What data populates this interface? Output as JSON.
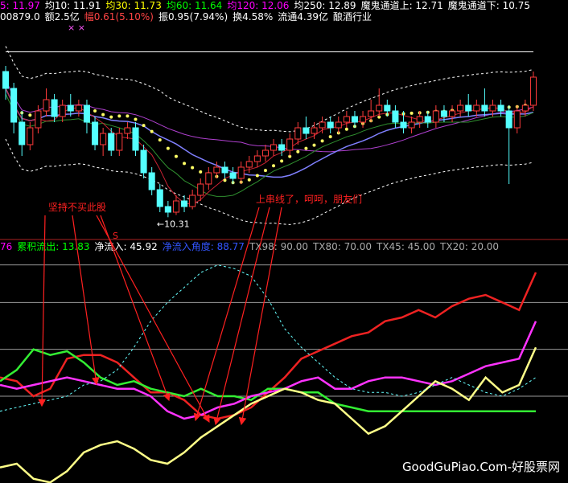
{
  "header": {
    "ma_items": [
      {
        "text": "5: 11.97",
        "color": "#ff00ff"
      },
      {
        "text": "均10: 11.91",
        "color": "#ffffff"
      },
      {
        "text": "均30: 11.73",
        "color": "#ffff00"
      },
      {
        "text": "均60: 11.64",
        "color": "#00ff00"
      },
      {
        "text": "均120: 12.06",
        "color": "#ff00ff"
      },
      {
        "text": "均250: 12.89",
        "color": "#ffffff"
      },
      {
        "text": "魔鬼通道上: 12.71",
        "color": "#ffffff"
      },
      {
        "text": "魔鬼通道下: 10.75",
        "color": "#ffffff"
      }
    ],
    "info_items": [
      {
        "text": "00879.0",
        "color": "#ffffff"
      },
      {
        "text": "额2.5亿",
        "color": "#ffffff"
      },
      {
        "text": "幅0.61(5.10%)",
        "color": "#ff4444"
      },
      {
        "text": "振0.95(7.94%)",
        "color": "#ffffff"
      },
      {
        "text": "换4.58%",
        "color": "#ffffff"
      },
      {
        "text": "流通4.39亿",
        "color": "#ffffff"
      },
      {
        "text": "酿酒行业",
        "color": "#ffffff"
      }
    ],
    "marks": "× ×"
  },
  "indicator_header": [
    {
      "text": "76",
      "color": "#ff00ff"
    },
    {
      "text": "累积流出: 13.83",
      "color": "#00ff00"
    },
    {
      "text": "净流入: 45.92",
      "color": "#ffffff"
    },
    {
      "text": "净流入角度: 88.77",
      "color": "#3355ff"
    },
    {
      "text": "TX98: 90.00",
      "color": "#aaaaaa"
    },
    {
      "text": "TX80: 70.00",
      "color": "#aaaaaa"
    },
    {
      "text": "TX45: 45.00",
      "color": "#aaaaaa"
    },
    {
      "text": "TX20: 20.00",
      "color": "#aaaaaa"
    }
  ],
  "annotations": {
    "left": "坚持不买此股",
    "right": "上串线了，呵呵，朋友们",
    "low_price": "10.31",
    "marker": "S"
  },
  "watermark": "GoodGuPiao.Com-好股票网",
  "colors": {
    "up": "#ff3b3b",
    "down": "#54ffff",
    "annotation": "#ff2020",
    "ma_white": "#ffffff",
    "ma_green": "#2f8f2f",
    "ma_purple": "#b040d0",
    "ma_blue": "#8080ff",
    "ma_yellow_dots": "#ffff66",
    "line_red": "#ee2222",
    "line_magenta": "#ff33ff",
    "line_green": "#33ee33",
    "line_yellow": "#ffff88",
    "line_cyan_dash": "#66ffff"
  },
  "chart_data": [
    {
      "type": "line",
      "name": "price-panel",
      "x": [
        1,
        2,
        3,
        4,
        5,
        6,
        7,
        8,
        9,
        10,
        11,
        12,
        13,
        14,
        15,
        16,
        17,
        18,
        19,
        20,
        21,
        22,
        23,
        24,
        25,
        26,
        27,
        28,
        29,
        30,
        31,
        32,
        33,
        34,
        35,
        36,
        37,
        38,
        39,
        40,
        41,
        42,
        43,
        44,
        45,
        46,
        47,
        48,
        49,
        50,
        51,
        52,
        53,
        54,
        55,
        56,
        57,
        58,
        59,
        60,
        61,
        62,
        63,
        64,
        65,
        66
      ],
      "candles": [
        {
          "o": 12.9,
          "c": 12.6,
          "h": 13.0,
          "l": 12.4
        },
        {
          "o": 12.6,
          "c": 12.0,
          "h": 12.7,
          "l": 11.8
        },
        {
          "o": 12.0,
          "c": 11.6,
          "h": 12.2,
          "l": 11.4
        },
        {
          "o": 11.6,
          "c": 11.9,
          "h": 12.0,
          "l": 11.5
        },
        {
          "o": 11.9,
          "c": 12.2,
          "h": 12.3,
          "l": 11.8
        },
        {
          "o": 12.2,
          "c": 12.4,
          "h": 12.6,
          "l": 12.1
        },
        {
          "o": 12.4,
          "c": 12.1,
          "h": 12.5,
          "l": 12.0
        },
        {
          "o": 12.1,
          "c": 12.3,
          "h": 12.4,
          "l": 12.0
        },
        {
          "o": 12.3,
          "c": 12.2,
          "h": 12.5,
          "l": 12.1
        },
        {
          "o": 12.2,
          "c": 12.3,
          "h": 12.4,
          "l": 12.1
        },
        {
          "o": 12.3,
          "c": 12.0,
          "h": 12.4,
          "l": 11.8
        },
        {
          "o": 12.0,
          "c": 11.6,
          "h": 12.1,
          "l": 11.5
        },
        {
          "o": 11.6,
          "c": 11.8,
          "h": 11.9,
          "l": 11.4
        },
        {
          "o": 11.8,
          "c": 11.5,
          "h": 11.9,
          "l": 11.4
        },
        {
          "o": 11.5,
          "c": 11.8,
          "h": 11.9,
          "l": 11.4
        },
        {
          "o": 11.8,
          "c": 11.9,
          "h": 12.0,
          "l": 11.7
        },
        {
          "o": 11.9,
          "c": 11.5,
          "h": 12.0,
          "l": 11.4
        },
        {
          "o": 11.5,
          "c": 11.1,
          "h": 11.6,
          "l": 11.0
        },
        {
          "o": 11.1,
          "c": 10.8,
          "h": 11.2,
          "l": 10.7
        },
        {
          "o": 10.8,
          "c": 10.5,
          "h": 10.9,
          "l": 10.4
        },
        {
          "o": 10.5,
          "c": 10.4,
          "h": 10.6,
          "l": 10.31
        },
        {
          "o": 10.4,
          "c": 10.6,
          "h": 10.7,
          "l": 10.35
        },
        {
          "o": 10.6,
          "c": 10.5,
          "h": 10.7,
          "l": 10.4
        },
        {
          "o": 10.5,
          "c": 10.7,
          "h": 10.8,
          "l": 10.45
        },
        {
          "o": 10.7,
          "c": 10.9,
          "h": 11.0,
          "l": 10.6
        },
        {
          "o": 10.9,
          "c": 11.1,
          "h": 11.2,
          "l": 10.8
        },
        {
          "o": 11.1,
          "c": 11.2,
          "h": 11.3,
          "l": 11.0
        },
        {
          "o": 11.2,
          "c": 11.1,
          "h": 11.3,
          "l": 11.0
        },
        {
          "o": 11.1,
          "c": 11.0,
          "h": 11.2,
          "l": 10.9
        },
        {
          "o": 11.0,
          "c": 11.2,
          "h": 11.3,
          "l": 10.9
        },
        {
          "o": 11.2,
          "c": 11.3,
          "h": 11.4,
          "l": 11.1
        },
        {
          "o": 11.3,
          "c": 11.4,
          "h": 11.5,
          "l": 11.2
        },
        {
          "o": 11.4,
          "c": 11.5,
          "h": 11.6,
          "l": 11.3
        },
        {
          "o": 11.5,
          "c": 11.6,
          "h": 11.7,
          "l": 11.4
        },
        {
          "o": 11.6,
          "c": 11.5,
          "h": 11.7,
          "l": 11.4
        },
        {
          "o": 11.5,
          "c": 11.7,
          "h": 11.8,
          "l": 11.4
        },
        {
          "o": 11.7,
          "c": 11.9,
          "h": 12.0,
          "l": 11.6
        },
        {
          "o": 11.9,
          "c": 11.8,
          "h": 12.1,
          "l": 11.7
        },
        {
          "o": 11.8,
          "c": 11.9,
          "h": 12.0,
          "l": 11.7
        },
        {
          "o": 11.9,
          "c": 12.0,
          "h": 12.1,
          "l": 11.8
        },
        {
          "o": 12.0,
          "c": 11.9,
          "h": 12.1,
          "l": 11.8
        },
        {
          "o": 11.9,
          "c": 12.0,
          "h": 12.1,
          "l": 11.8
        },
        {
          "o": 12.0,
          "c": 12.1,
          "h": 12.2,
          "l": 11.9
        },
        {
          "o": 12.1,
          "c": 12.0,
          "h": 12.2,
          "l": 11.9
        },
        {
          "o": 12.0,
          "c": 12.1,
          "h": 12.2,
          "l": 11.9
        },
        {
          "o": 12.1,
          "c": 12.2,
          "h": 12.4,
          "l": 12.0
        },
        {
          "o": 12.2,
          "c": 12.3,
          "h": 12.6,
          "l": 12.1
        },
        {
          "o": 12.3,
          "c": 12.2,
          "h": 12.4,
          "l": 12.1
        },
        {
          "o": 12.2,
          "c": 12.0,
          "h": 12.3,
          "l": 11.9
        },
        {
          "o": 12.0,
          "c": 11.9,
          "h": 12.2,
          "l": 11.8
        },
        {
          "o": 11.9,
          "c": 12.0,
          "h": 12.1,
          "l": 11.8
        },
        {
          "o": 12.0,
          "c": 12.1,
          "h": 12.2,
          "l": 11.9
        },
        {
          "o": 12.1,
          "c": 12.0,
          "h": 12.2,
          "l": 11.9
        },
        {
          "o": 12.0,
          "c": 12.2,
          "h": 12.3,
          "l": 11.9
        },
        {
          "o": 12.2,
          "c": 12.1,
          "h": 12.3,
          "l": 12.0
        },
        {
          "o": 12.1,
          "c": 12.2,
          "h": 12.3,
          "l": 12.0
        },
        {
          "o": 12.2,
          "c": 12.3,
          "h": 12.4,
          "l": 12.1
        },
        {
          "o": 12.3,
          "c": 12.2,
          "h": 12.5,
          "l": 12.1
        },
        {
          "o": 12.2,
          "c": 12.3,
          "h": 12.4,
          "l": 12.1
        },
        {
          "o": 12.3,
          "c": 12.2,
          "h": 12.6,
          "l": 12.1
        },
        {
          "o": 12.2,
          "c": 12.3,
          "h": 12.4,
          "l": 12.1
        },
        {
          "o": 12.3,
          "c": 12.2,
          "h": 12.4,
          "l": 12.1
        },
        {
          "o": 12.2,
          "c": 11.9,
          "h": 12.3,
          "l": 10.9
        },
        {
          "o": 11.9,
          "c": 12.2,
          "h": 12.3,
          "l": 11.8
        },
        {
          "o": 12.2,
          "c": 12.3,
          "h": 12.4,
          "l": 12.1
        },
        {
          "o": 12.3,
          "c": 12.8,
          "h": 12.9,
          "l": 12.2
        }
      ],
      "ylim": [
        10.0,
        13.6
      ]
    },
    {
      "type": "line",
      "name": "indicator-panel",
      "x": [
        1,
        2,
        3,
        4,
        5,
        6,
        7,
        8,
        9,
        10,
        11,
        12,
        13,
        14,
        15,
        16,
        17,
        18,
        19,
        20,
        21,
        22,
        23,
        24,
        25,
        26,
        27,
        28,
        29,
        30,
        31,
        32,
        33
      ],
      "series": [
        {
          "name": "净流入",
          "color_key": "line_red",
          "values": [
            30,
            28,
            20,
            24,
            40,
            42,
            42,
            38,
            30,
            22,
            22,
            18,
            10,
            8,
            10,
            14,
            22,
            30,
            40,
            44,
            48,
            52,
            54,
            60,
            62,
            66,
            62,
            68,
            72,
            74,
            70,
            66,
            86
          ]
        },
        {
          "name": "累积流出",
          "color_key": "line_green",
          "values": [
            28,
            34,
            45,
            42,
            44,
            38,
            30,
            26,
            28,
            24,
            22,
            20,
            24,
            20,
            20,
            18,
            24,
            24,
            22,
            22,
            16,
            14,
            12,
            12,
            12,
            12,
            12,
            12,
            12,
            12,
            12,
            12,
            12
          ]
        },
        {
          "name": "净流入角度",
          "color_key": "line_magenta",
          "values": [
            26,
            24,
            26,
            28,
            30,
            28,
            26,
            24,
            24,
            20,
            12,
            8,
            10,
            14,
            16,
            20,
            22,
            24,
            28,
            30,
            24,
            24,
            28,
            30,
            30,
            28,
            26,
            28,
            32,
            36,
            38,
            40,
            60
          ]
        },
        {
          "name": "TX",
          "color_key": "line_yellow",
          "values": [
            -18,
            -16,
            -24,
            -26,
            -20,
            -10,
            -6,
            -4,
            -8,
            -14,
            -16,
            -10,
            -2,
            4,
            10,
            16,
            20,
            24,
            22,
            18,
            16,
            8,
            0,
            4,
            12,
            20,
            28,
            24,
            18,
            30,
            22,
            26,
            46
          ]
        },
        {
          "name": "曲线",
          "color_key": "line_cyan_dash",
          "values": [
            12,
            14,
            16,
            18,
            20,
            26,
            28,
            34,
            46,
            60,
            70,
            78,
            86,
            90,
            88,
            84,
            72,
            56,
            46,
            38,
            30,
            24,
            22,
            22,
            20,
            22,
            26,
            30,
            26,
            22,
            20,
            24,
            30
          ]
        }
      ],
      "reference_levels": [
        90,
        70,
        45,
        20
      ],
      "ylim": [
        -25,
        95
      ]
    }
  ]
}
